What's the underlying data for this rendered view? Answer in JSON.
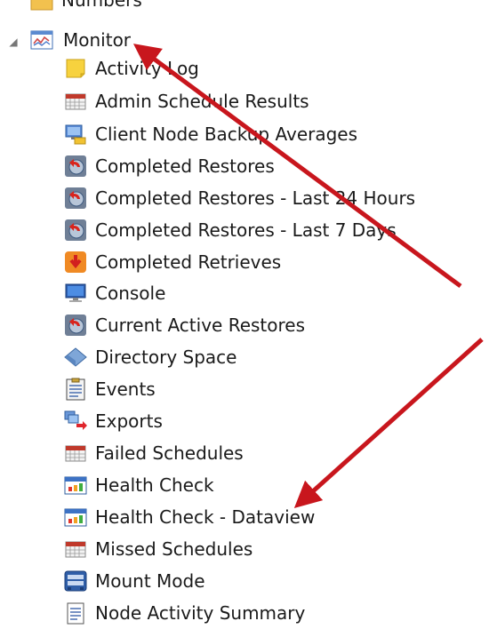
{
  "tree": {
    "numbers_label": "Numbers",
    "monitor_label": "Monitor",
    "items": [
      {
        "label": "Activity Log",
        "icon": "activity-log-icon"
      },
      {
        "label": "Admin Schedule Results",
        "icon": "schedule-grid-icon"
      },
      {
        "label": "Client Node Backup Averages",
        "icon": "client-node-icon"
      },
      {
        "label": "Completed Restores",
        "icon": "restore-icon"
      },
      {
        "label": "Completed Restores - Last 24 Hours",
        "icon": "restore-icon"
      },
      {
        "label": "Completed Restores - Last 7 Days",
        "icon": "restore-icon"
      },
      {
        "label": "Completed Retrieves",
        "icon": "retrieve-icon"
      },
      {
        "label": "Console",
        "icon": "console-icon"
      },
      {
        "label": "Current Active Restores",
        "icon": "restore-icon"
      },
      {
        "label": "Directory Space",
        "icon": "directory-space-icon"
      },
      {
        "label": "Events",
        "icon": "events-icon"
      },
      {
        "label": "Exports",
        "icon": "exports-icon"
      },
      {
        "label": "Failed Schedules",
        "icon": "schedule-grid-icon"
      },
      {
        "label": "Health Check",
        "icon": "health-check-icon"
      },
      {
        "label": "Health Check - Dataview",
        "icon": "health-check-icon"
      },
      {
        "label": "Missed Schedules",
        "icon": "schedule-grid-icon"
      },
      {
        "label": "Mount Mode",
        "icon": "mount-mode-icon"
      },
      {
        "label": "Node Activity Summary",
        "icon": "summary-document-icon"
      }
    ]
  },
  "colors": {
    "arrow": "#c8161d",
    "text": "#1a1a1a"
  }
}
